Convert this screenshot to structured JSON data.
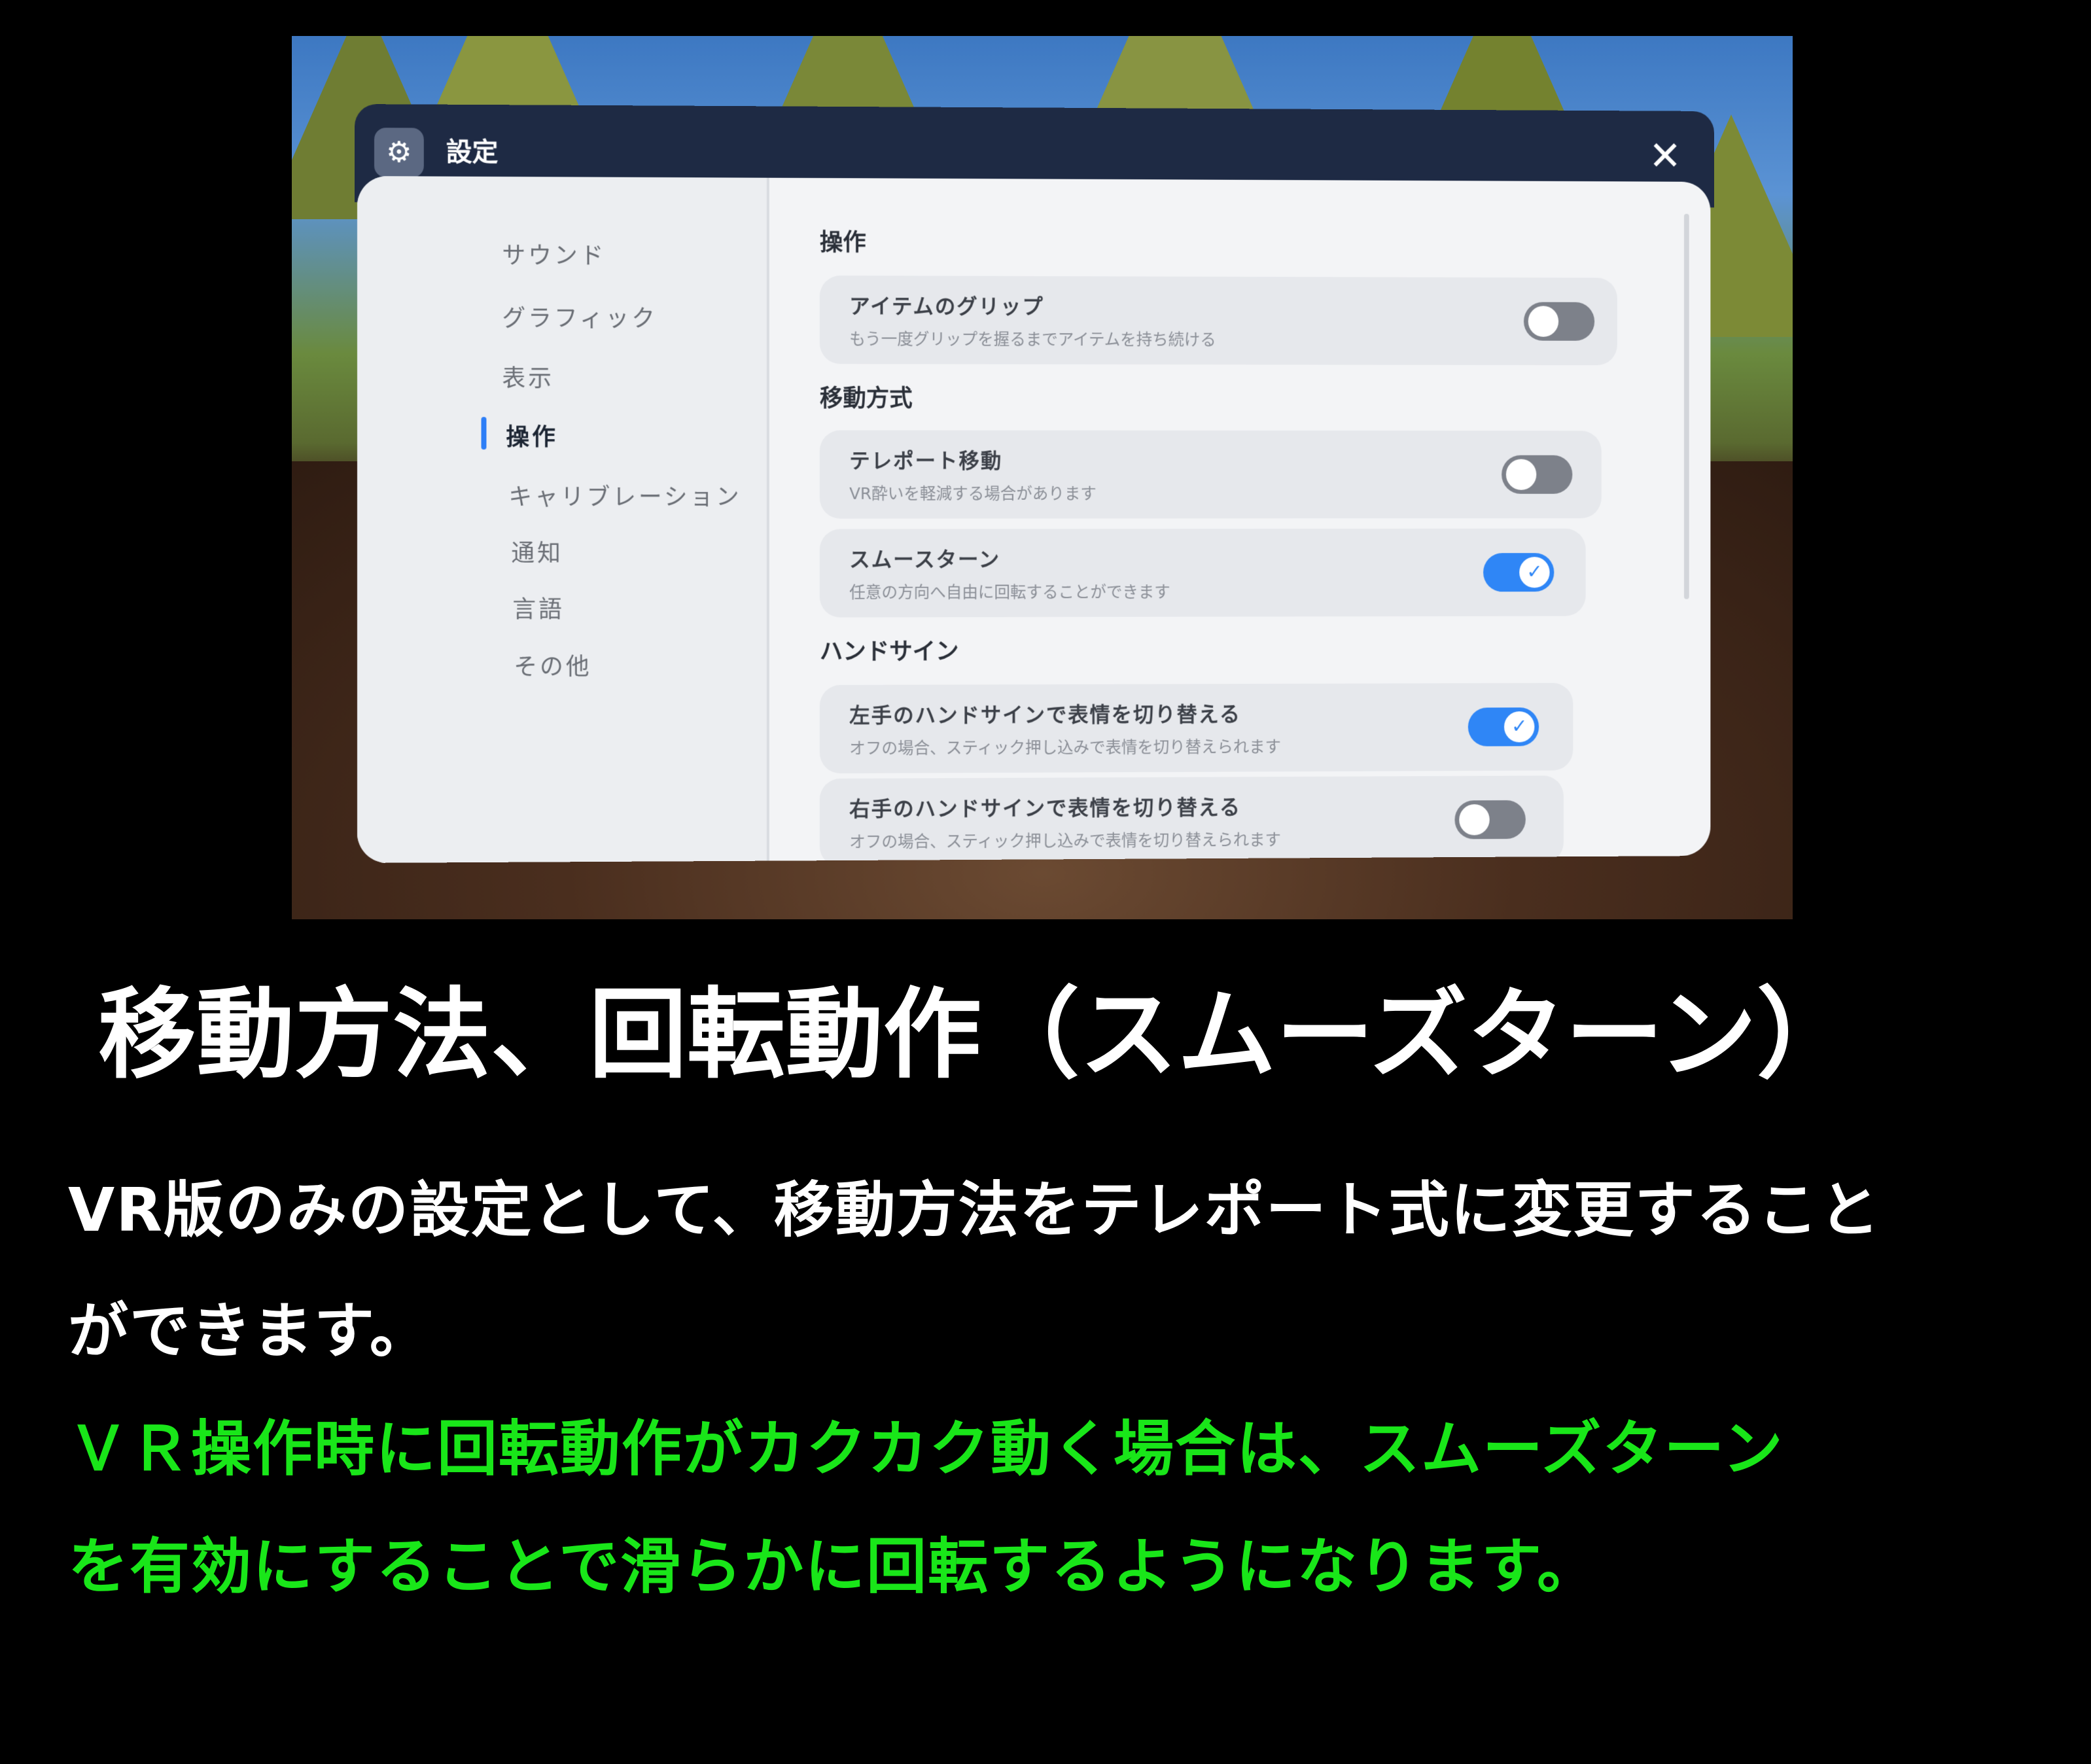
{
  "window": {
    "title": "設定",
    "close_glyph": "✕",
    "icon_glyph": "⚙"
  },
  "sidebar": {
    "items": [
      {
        "label": "サウンド"
      },
      {
        "label": "グラフィック"
      },
      {
        "label": "表示"
      },
      {
        "label": "操作",
        "active": true
      },
      {
        "label": "キャリブレーション"
      },
      {
        "label": "通知"
      },
      {
        "label": "言語"
      },
      {
        "label": "その他"
      }
    ]
  },
  "content": {
    "sections": [
      {
        "heading": "操作",
        "settings": [
          {
            "title": "アイテムのグリップ",
            "desc": "もう一度グリップを握るまでアイテムを持ち続ける",
            "enabled": false
          }
        ]
      },
      {
        "heading": "移動方式",
        "settings": [
          {
            "title": "テレポート移動",
            "desc": "VR酔いを軽減する場合があります",
            "enabled": false
          },
          {
            "title": "スムースターン",
            "desc": "任意の方向へ自由に回転することができます",
            "enabled": true
          }
        ]
      },
      {
        "heading": "ハンドサイン",
        "settings": [
          {
            "title": "左手のハンドサインで表情を切り替える",
            "desc": "オフの場合、スティック押し込みで表情を切り替えられます",
            "enabled": true
          },
          {
            "title": "右手のハンドサインで表情を切り替える",
            "desc": "オフの場合、スティック押し込みで表情を切り替えられます",
            "enabled": false
          }
        ]
      }
    ],
    "check_glyph": "✓"
  },
  "caption": {
    "heading": "移動方法、回転動作（スムーズターン）",
    "para1": [
      "VR版のみの設定として、移動方法をテレポート式に変更すること",
      "ができます。"
    ],
    "para2": [
      "ＶＲ操作時に回転動作がカクカク動く場合は、スムーズターン",
      "を有効にすることで滑らかに回転するようになります。"
    ],
    "colors": {
      "para1": "#ffffff",
      "para2": "#19e619",
      "toggle_on": "#2f86f6"
    }
  }
}
